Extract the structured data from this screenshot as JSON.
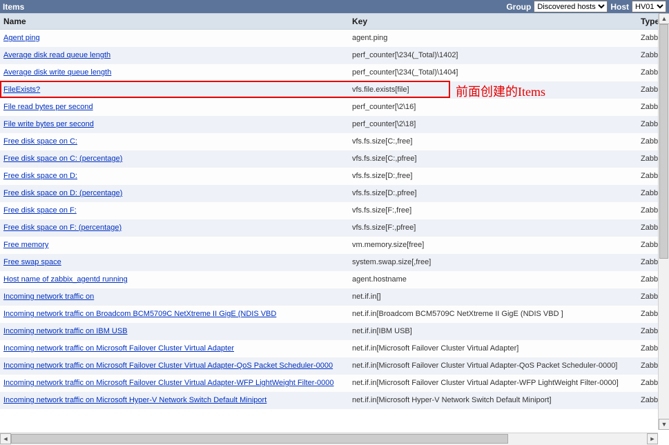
{
  "header": {
    "title": "Items",
    "group_label": "Group",
    "group_value": "Discovered hosts",
    "host_label": "Host",
    "host_value": "HV01"
  },
  "columns": {
    "name": "Name",
    "key": "Key",
    "type": "Type"
  },
  "type_text": "Zabb",
  "annotation": "前面创建的Items",
  "rows": [
    {
      "name": "Agent ping",
      "key": "agent.ping"
    },
    {
      "name": "Average disk read queue length",
      "key": "perf_counter[\\234(_Total)\\1402]"
    },
    {
      "name": "Average disk write queue length",
      "key": "perf_counter[\\234(_Total)\\1404]"
    },
    {
      "name": "FileExists?",
      "key": "vfs.file.exists[file]",
      "highlight": true
    },
    {
      "name": "File read bytes per second",
      "key": "perf_counter[\\2\\16]"
    },
    {
      "name": "File write bytes per second",
      "key": "perf_counter[\\2\\18]"
    },
    {
      "name": "Free disk space on C:",
      "key": "vfs.fs.size[C:,free]"
    },
    {
      "name": "Free disk space on C: (percentage)",
      "key": "vfs.fs.size[C:,pfree]"
    },
    {
      "name": "Free disk space on D:",
      "key": "vfs.fs.size[D:,free]"
    },
    {
      "name": "Free disk space on D: (percentage)",
      "key": "vfs.fs.size[D:,pfree]"
    },
    {
      "name": "Free disk space on F:",
      "key": "vfs.fs.size[F:,free]"
    },
    {
      "name": "Free disk space on F: (percentage)",
      "key": "vfs.fs.size[F:,pfree]"
    },
    {
      "name": "Free memory",
      "key": "vm.memory.size[free]"
    },
    {
      "name": "Free swap space",
      "key": "system.swap.size[,free]"
    },
    {
      "name": "Host name of zabbix_agentd running",
      "key": "agent.hostname"
    },
    {
      "name": "Incoming network traffic on",
      "key": "net.if.in[]"
    },
    {
      "name": "Incoming network traffic on Broadcom BCM5709C NetXtreme II GigE (NDIS VBD",
      "key": "net.if.in[Broadcom BCM5709C NetXtreme II GigE (NDIS VBD ]"
    },
    {
      "name": "Incoming network traffic on IBM USB",
      "key": "net.if.in[IBM USB]"
    },
    {
      "name": "Incoming network traffic on Microsoft Failover Cluster Virtual Adapter",
      "key": "net.if.in[Microsoft Failover Cluster Virtual Adapter]"
    },
    {
      "name": "Incoming network traffic on Microsoft Failover Cluster Virtual Adapter-QoS Packet Scheduler-0000",
      "key": "net.if.in[Microsoft Failover Cluster Virtual Adapter-QoS Packet Scheduler-0000]"
    },
    {
      "name": "Incoming network traffic on Microsoft Failover Cluster Virtual Adapter-WFP LightWeight Filter-0000",
      "key": "net.if.in[Microsoft Failover Cluster Virtual Adapter-WFP LightWeight Filter-0000]"
    },
    {
      "name": "Incoming network traffic on Microsoft Hyper-V Network Switch Default Miniport",
      "key": "net.if.in[Microsoft Hyper-V Network Switch Default Miniport]"
    }
  ]
}
